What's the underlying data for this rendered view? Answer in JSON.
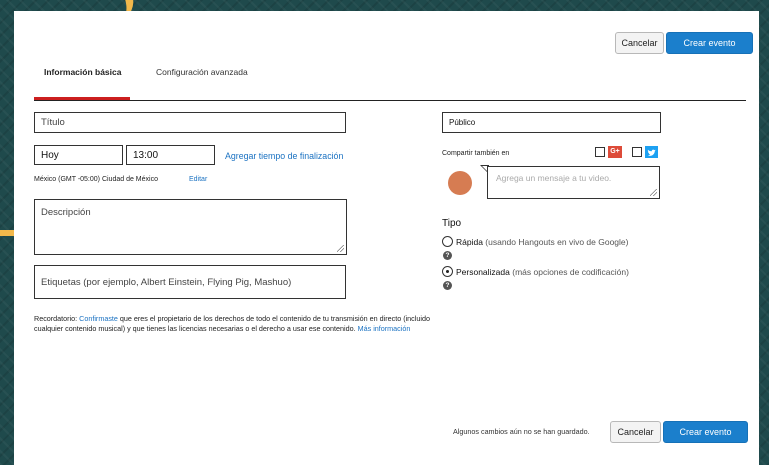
{
  "header": {
    "cancel_label": "Cancelar",
    "create_label": "Crear evento"
  },
  "tabs": [
    {
      "label": "Información básica",
      "active": true
    },
    {
      "label": "Configuración avanzada",
      "active": false
    }
  ],
  "left": {
    "title_placeholder": "Título",
    "date_value": "Hoy",
    "time_value": "13:00",
    "add_end_time_link": "Agregar tiempo de finalización",
    "timezone": "México (GMT -05:00) Ciudad de México",
    "edit_link": "Editar",
    "description_placeholder": "Descripción",
    "tags_placeholder": "Etiquetas (por ejemplo, Albert Einstein, Flying Pig, Mashuo)",
    "reminder_prefix": "Recordatorio: ",
    "reminder_link": "Confirmaste",
    "reminder_body": " que eres el propietario de los derechos de todo el contenido de tu transmisión en directo (incluido cualquier contenido musical) y que tienes las licencias necesarias o el derecho a usar ese contenido. ",
    "more_info_link": "Más información"
  },
  "right": {
    "privacy_value": "Público",
    "share_label": "Compartir también en",
    "gplus_icon": "G+",
    "message_placeholder": "Agrega un mensaje a tu video.",
    "type_title": "Tipo",
    "option_quick_bold": "Rápida",
    "option_quick_rest": " (usando Hangouts en vivo de Google)",
    "option_custom_bold": "Personalizada",
    "option_custom_rest": " (más opciones de codificación)",
    "selected_type": "Personalizada",
    "help_glyph": "?"
  },
  "footer": {
    "status": "Algunos cambios aún no se han guardado.",
    "cancel_label": "Cancelar",
    "create_label": "Crear evento"
  },
  "colors": {
    "accent": "#1b7fcc",
    "tab_active_underline": "#cc1f1f",
    "avatar": "#d67c52",
    "background": "#1f4a4c"
  }
}
